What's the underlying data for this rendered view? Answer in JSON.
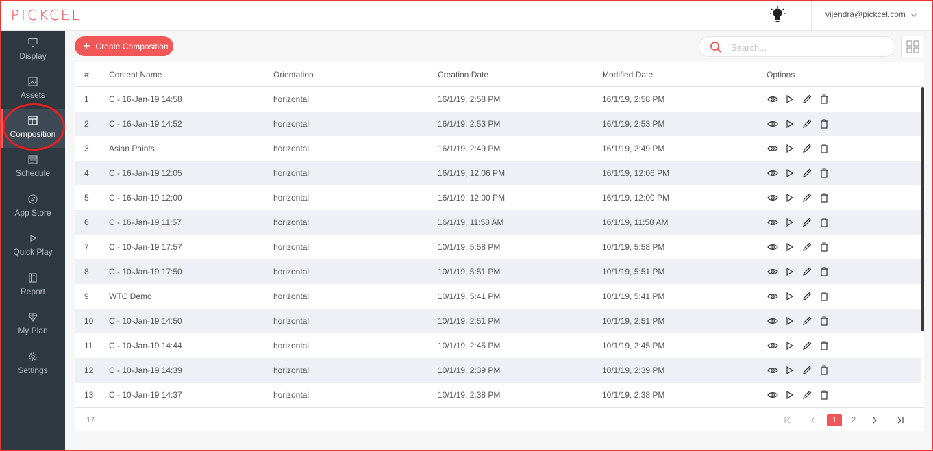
{
  "app": {
    "logo_text": "PICKCEL",
    "user_email": "vijendra@pickcel.com",
    "accent_color": "#f25757"
  },
  "sidebar": {
    "items": [
      {
        "label": "Display",
        "icon": "monitor-icon",
        "active": false
      },
      {
        "label": "Assets",
        "icon": "image-icon",
        "active": false
      },
      {
        "label": "Composition",
        "icon": "layout-icon",
        "active": true
      },
      {
        "label": "Schedule",
        "icon": "calendar-icon",
        "active": false
      },
      {
        "label": "App Store",
        "icon": "compass-icon",
        "active": false
      },
      {
        "label": "Quick Play",
        "icon": "play-icon",
        "active": false
      },
      {
        "label": "Report",
        "icon": "report-icon",
        "active": false
      },
      {
        "label": "My Plan",
        "icon": "diamond-icon",
        "active": false
      },
      {
        "label": "Settings",
        "icon": "gear-icon",
        "active": false
      }
    ]
  },
  "toolbar": {
    "create_label": "Create Composition",
    "search_placeholder": "Search...",
    "search_value": ""
  },
  "table": {
    "columns": [
      "#",
      "Content Name",
      "Orientation",
      "Creation Date",
      "Modified Date",
      "Options"
    ],
    "rows": [
      {
        "num": "1",
        "name": "C - 16-Jan-19 14:58",
        "orientation": "horizontal",
        "created": "16/1/19, 2:58 PM",
        "modified": "16/1/19, 2:58 PM"
      },
      {
        "num": "2",
        "name": "C - 16-Jan-19 14:52",
        "orientation": "horizontal",
        "created": "16/1/19, 2:53 PM",
        "modified": "16/1/19, 2:53 PM"
      },
      {
        "num": "3",
        "name": "Asian Paints",
        "orientation": "horizontal",
        "created": "16/1/19, 2:49 PM",
        "modified": "16/1/19, 2:49 PM"
      },
      {
        "num": "4",
        "name": "C - 16-Jan-19 12:05",
        "orientation": "horizontal",
        "created": "16/1/19, 12:06 PM",
        "modified": "16/1/19, 12:06 PM"
      },
      {
        "num": "5",
        "name": "C - 16-Jan-19 12:00",
        "orientation": "horizontal",
        "created": "16/1/19, 12:00 PM",
        "modified": "16/1/19, 12:00 PM"
      },
      {
        "num": "6",
        "name": "C - 16-Jan-19 11:57",
        "orientation": "horizontal",
        "created": "16/1/19, 11:58 AM",
        "modified": "16/1/19, 11:58 AM"
      },
      {
        "num": "7",
        "name": "C - 10-Jan-19 17:57",
        "orientation": "horizontal",
        "created": "10/1/19, 5:58 PM",
        "modified": "10/1/19, 5:58 PM"
      },
      {
        "num": "8",
        "name": "C - 10-Jan-19 17:50",
        "orientation": "horizontal",
        "created": "10/1/19, 5:51 PM",
        "modified": "10/1/19, 5:51 PM"
      },
      {
        "num": "9",
        "name": "WTC Demo",
        "orientation": "horizontal",
        "created": "10/1/19, 5:41 PM",
        "modified": "10/1/19, 5:41 PM"
      },
      {
        "num": "10",
        "name": "C - 10-Jan-19 14:50",
        "orientation": "horizontal",
        "created": "10/1/19, 2:51 PM",
        "modified": "10/1/19, 2:51 PM"
      },
      {
        "num": "11",
        "name": "C - 10-Jan-19 14:44",
        "orientation": "horizontal",
        "created": "10/1/19, 2:45 PM",
        "modified": "10/1/19, 2:45 PM"
      },
      {
        "num": "12",
        "name": "C - 10-Jan-19 14:39",
        "orientation": "horizontal",
        "created": "10/1/19, 2:39 PM",
        "modified": "10/1/19, 2:39 PM"
      },
      {
        "num": "13",
        "name": "C - 10-Jan-19 14:37",
        "orientation": "horizontal",
        "created": "10/1/19, 2:38 PM",
        "modified": "10/1/19, 2:38 PM"
      }
    ]
  },
  "footer": {
    "total_count": "17",
    "pages": [
      "1",
      "2"
    ],
    "current_page": "1"
  }
}
